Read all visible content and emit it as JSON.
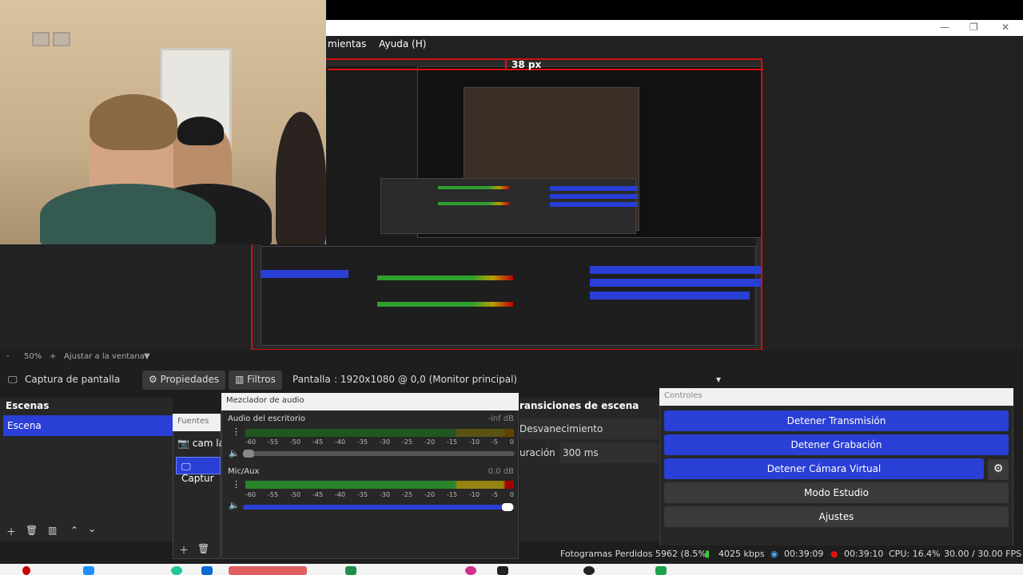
{
  "menu": {
    "items": [
      "mientas",
      "Ayuda (H)"
    ]
  },
  "preview": {
    "guide_label": "38 px"
  },
  "zoom": {
    "minus": "-",
    "value": "50%",
    "plus": "+",
    "fit": "Ajustar a la ventana"
  },
  "sourcebar": {
    "source_name": "Captura de pantalla",
    "properties": "Propiedades",
    "filters": "Filtros",
    "screen_label": "Pantalla",
    "screen_value": ": 1920x1080 @ 0,0 (Monitor principal)"
  },
  "scenes": {
    "title": "Escenas",
    "items": [
      "Escena"
    ]
  },
  "sources": {
    "title": "Fuentes",
    "items": [
      "cam la",
      "Captur"
    ]
  },
  "mixer": {
    "title": "Mezclador de audio",
    "tracks": [
      {
        "name": "Audio del escritorio",
        "db": "-inf dB"
      },
      {
        "name": "Mic/Aux",
        "db": "0.0 dB"
      }
    ],
    "scale": [
      "-60",
      "-55",
      "-50",
      "-45",
      "-40",
      "-35",
      "-30",
      "-25",
      "-20",
      "-15",
      "-10",
      "-5",
      "0"
    ]
  },
  "transitions": {
    "title": "ransiciones de escena",
    "type": "Desvanecimiento",
    "duration_label": "uración",
    "duration_value": "300 ms"
  },
  "controls": {
    "title": "Controles",
    "buttons": [
      "Detener Transmisión",
      "Detener Grabación",
      "Detener Cámara Virtual",
      "Modo Estudio",
      "Ajustes"
    ]
  },
  "status": {
    "dropped": "Fotogramas Perdidos 5962 (8.5%)",
    "bitrate": "4025 kbps",
    "stream_time": "00:39:09",
    "rec_time": "00:39:10",
    "cpu": "CPU: 16.4%",
    "fps": "30.00 / 30.00 FPS"
  },
  "colors": {
    "accent": "#2a3fd6",
    "record": "#e01010"
  }
}
